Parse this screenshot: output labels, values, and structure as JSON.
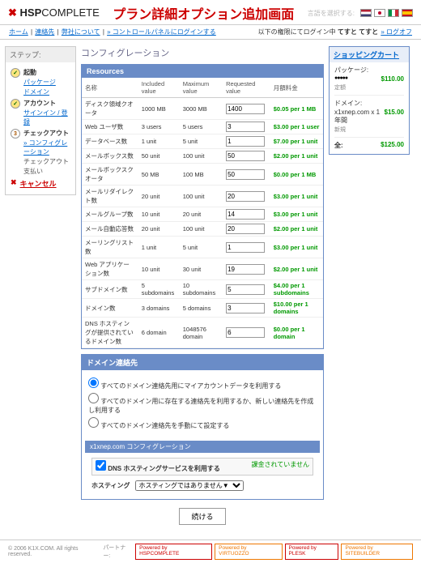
{
  "header": {
    "logo_prefix": "HSP",
    "logo_suffix": "COMPLETE",
    "page_title": "プラン詳細オプション追加画面",
    "lang_label": "言語を選択する:"
  },
  "topbar": {
    "home": "ホーム",
    "contact": "連絡先",
    "about": "弊社について",
    "cp": "» コントロールパネルにログインする",
    "right_pre": "以下の権限にてログイン中",
    "user": "てすと てすと",
    "logout": "» ログオフ"
  },
  "steps": {
    "title": "ステップ:",
    "s1": {
      "label": "起動",
      "sub1": "パッケージ",
      "sub2": "ドメイン"
    },
    "s2": {
      "label": "アカウント",
      "sub1": "サインイン / 登録"
    },
    "s3": {
      "label": "チェックアウト",
      "sub1": "» コンフィグレーション",
      "sub2": "チェックアウト",
      "sub3": "支払い"
    },
    "cancel": "キャンセル"
  },
  "config_title": "コンフィグレーション",
  "resources": {
    "title": "Resources",
    "cols": {
      "name": "名称",
      "inc": "Included value",
      "max": "Maximum value",
      "req": "Requested value",
      "fee": "月額料金"
    },
    "rows": [
      {
        "n": "ディスク領域クオータ",
        "i": "1000 MB",
        "m": "3000 MB",
        "r": "1400",
        "f": "$0.05 per 1 MB"
      },
      {
        "n": "Web ユーザ数",
        "i": "3 users",
        "m": "5 users",
        "r": "3",
        "f": "$3.00 per 1 user"
      },
      {
        "n": "データベース数",
        "i": "1 unit",
        "m": "5 unit",
        "r": "1",
        "f": "$7.00 per 1 unit"
      },
      {
        "n": "メールボックス数",
        "i": "50 unit",
        "m": "100 unit",
        "r": "50",
        "f": "$2.00 per 1 unit"
      },
      {
        "n": "メールボックスクオータ",
        "i": "50 MB",
        "m": "100 MB",
        "r": "50",
        "f": "$0.00 per 1 MB"
      },
      {
        "n": "メールリダイレクト数",
        "i": "20 unit",
        "m": "100 unit",
        "r": "20",
        "f": "$3.00 per 1 unit"
      },
      {
        "n": "メールグループ数",
        "i": "10 unit",
        "m": "20 unit",
        "r": "14",
        "f": "$3.00 per 1 unit"
      },
      {
        "n": "メール自動応答数",
        "i": "20 unit",
        "m": "100 unit",
        "r": "20",
        "f": "$2.00 per 1 unit"
      },
      {
        "n": "メーリングリスト数",
        "i": "1 unit",
        "m": "5 unit",
        "r": "1",
        "f": "$3.00 per 1 unit"
      },
      {
        "n": "Web アプリケーション数",
        "i": "10 unit",
        "m": "30 unit",
        "r": "19",
        "f": "$2.00 per 1 unit"
      },
      {
        "n": "サブドメイン数",
        "i": "5 subdomains",
        "m": "10 subdomains",
        "r": "5",
        "f": "$4.00 per 1 subdomains"
      },
      {
        "n": "ドメイン数",
        "i": "3 domains",
        "m": "5 domains",
        "r": "3",
        "f": "$10.00 per 1 domains"
      },
      {
        "n": "DNS ホスティングが提供されているドメイン数",
        "i": "6 domain",
        "m": "1048576 domain",
        "r": "6",
        "f": "$0.00 per 1 domain"
      }
    ]
  },
  "domain_panel": {
    "title": "ドメイン連絡先",
    "r1": "すべてのドメイン連絡先用にマイアカウントデータを利用する",
    "r2": "すべてのドメイン用に存在する連絡先を利用するか、新しい連絡先を作成し利用する",
    "r3": "すべてのドメイン連絡先を手動にて設定する",
    "sub_title": "x1xnep.com コンフィグレーション",
    "dns_label": "DNS ホスティングサービスを利用する",
    "dns_note": "課金されていません",
    "hosting_label": "ホスティング",
    "hosting_opt": "ホスティングではありません▼",
    "continue": "続ける"
  },
  "cart": {
    "title": "ショッピングカート",
    "pkg_label": "パッケージ:",
    "pkg_name": "●●●●●",
    "pkg_price": "$110.00",
    "pkg_note": "定額",
    "dom_label": "ドメイン:",
    "dom_name": "x1xnep.com x 1 年間",
    "dom_price": "$15.00",
    "dom_note": "新規",
    "total_label": "全:",
    "total": "$125.00"
  },
  "footer": {
    "copyright": "© 2006 K1X.COM. All rights reserved.",
    "partner": "パートナー:",
    "b1": "Powered by HSPCOMPLETE",
    "b2": "Powered by VIRTUOZZO",
    "b3": "Powered by PLESK",
    "b4": "Powered by SITEBUILDER"
  }
}
